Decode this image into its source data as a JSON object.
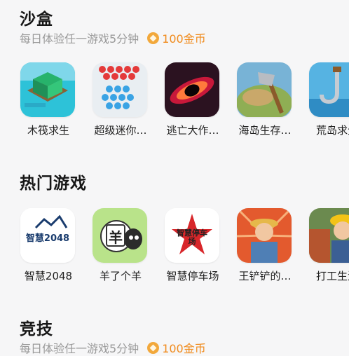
{
  "sections": [
    {
      "title": "沙盒",
      "subtitle": "每日体验任一游戏5分钟",
      "reward": "100金币",
      "games": [
        {
          "name": "木筏求生",
          "icon": "raft-game-icon"
        },
        {
          "name": "超级迷你…",
          "icon": "mini-crowd-game-icon"
        },
        {
          "name": "逃亡大作…",
          "icon": "black-hole-game-icon"
        },
        {
          "name": "海岛生存…",
          "icon": "island-axe-game-icon"
        },
        {
          "name": "荒岛求生",
          "icon": "hook-game-icon"
        }
      ]
    },
    {
      "title": "热门游戏",
      "games": [
        {
          "name": "智慧2048",
          "icon": "zhihui-2048-game-icon",
          "icon_text": "智慧2048"
        },
        {
          "name": "羊了个羊",
          "icon": "sheep-game-icon",
          "icon_text": "羊"
        },
        {
          "name": "智慧停车场",
          "icon": "parking-game-icon",
          "icon_text": "智慧停车场"
        },
        {
          "name": "王铲铲的…",
          "icon": "farmer-game-icon"
        },
        {
          "name": "打工生活",
          "icon": "worker-game-icon"
        }
      ]
    },
    {
      "title": "竞技",
      "subtitle": "每日体验任一游戏5分钟",
      "reward": "100金币"
    }
  ]
}
